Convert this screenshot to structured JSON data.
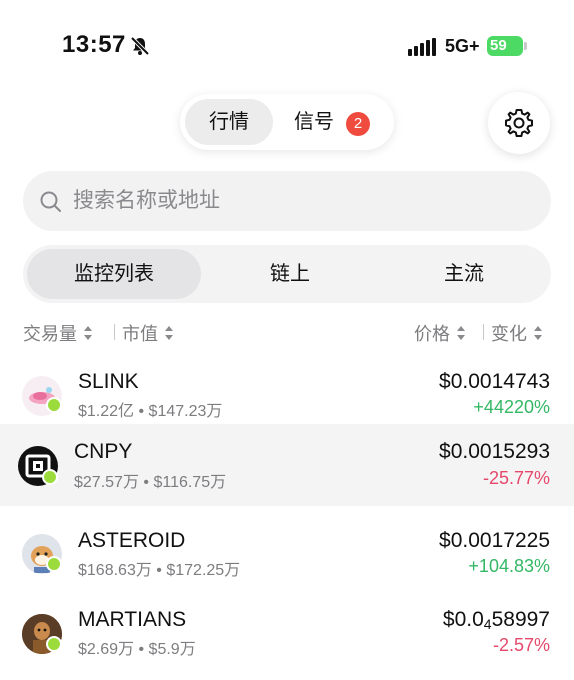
{
  "status_bar": {
    "time": "13:57",
    "network": "5G+",
    "battery": "59"
  },
  "header": {
    "tabs": [
      {
        "label": "行情",
        "active": true
      },
      {
        "label": "信号",
        "active": false
      }
    ],
    "signal_badge": "2",
    "icons": {
      "settings": "gear-icon",
      "mute": "bell-slash-icon"
    }
  },
  "search": {
    "placeholder": "搜索名称或地址",
    "value": ""
  },
  "sub_tabs": [
    {
      "label": "监控列表",
      "active": true
    },
    {
      "label": "链上",
      "active": false
    },
    {
      "label": "主流",
      "active": false
    }
  ],
  "sort_headers": {
    "volume": "交易量",
    "market_cap": "市值",
    "price": "价格",
    "change": "变化"
  },
  "tokens": [
    {
      "symbol": "SLINK",
      "volume": "$1.22亿",
      "market_cap": "$147.23万",
      "price": "$0.0014743",
      "change": "+44220%",
      "direction": "up"
    },
    {
      "symbol": "CNPY",
      "volume": "$27.57万",
      "market_cap": "$116.75万",
      "price": "$0.0015293",
      "change": "-25.77%",
      "direction": "down"
    },
    {
      "symbol": "ASTEROID",
      "volume": "$168.63万",
      "market_cap": "$172.25万",
      "price": "$0.0017225",
      "change": "+104.83%",
      "direction": "up"
    },
    {
      "symbol": "MARTIANS",
      "volume": "$2.69万",
      "market_cap": "$5.9万",
      "price_prefix": "$0.0",
      "price_zeros": "4",
      "price_digits": "58997",
      "change": "-2.57%",
      "direction": "down"
    }
  ],
  "colors": {
    "up": "#34b865",
    "down": "#e5486b",
    "badge": "#ef4b3f",
    "battery": "#4cd964",
    "chain_badge": "#9bdc3c"
  }
}
